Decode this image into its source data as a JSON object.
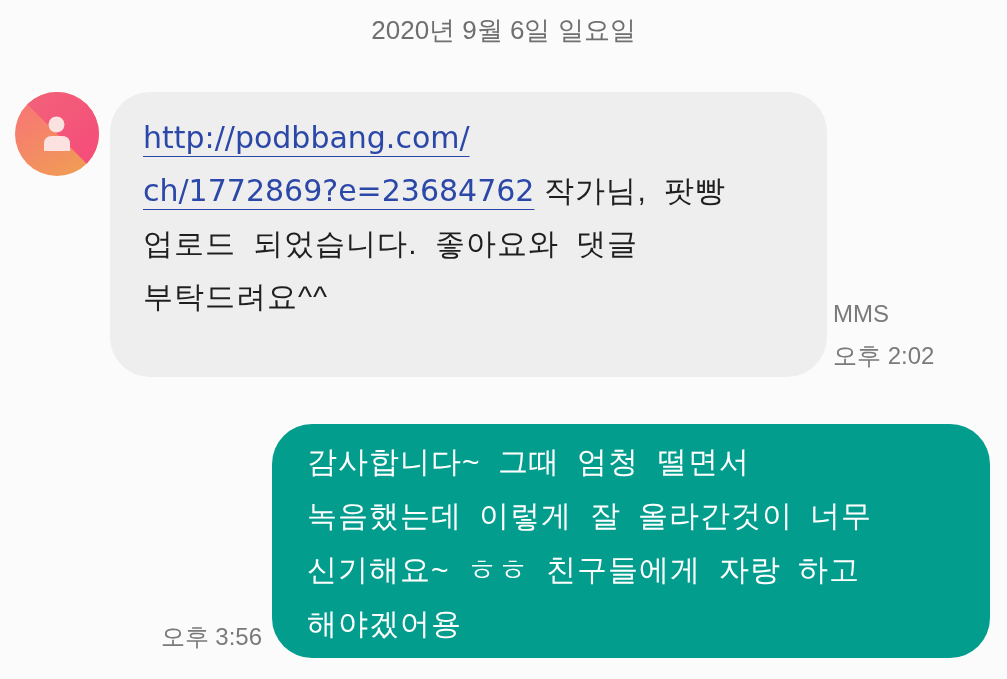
{
  "date_header": "2020년 9월 6일 일요일",
  "messages": [
    {
      "kind": "incoming",
      "link": [
        "http://podbbang.com/",
        "ch/1772869?e=23684762"
      ],
      "text": "작가님, 팟빵 업로드 되었습니다. 좋아요와 댓글 부탁드려요^^",
      "type_label": "MMS",
      "time": "오후 2:02"
    },
    {
      "kind": "outgoing",
      "text": "감사합니다~ 그때 엄청 떨면서 녹음했는데 이렇게 잘 올라간것이 너무 신기해요~ ㅎㅎ 친구들에게 자랑 하고 해야겠어용",
      "time": "오후 3:56"
    }
  ]
}
